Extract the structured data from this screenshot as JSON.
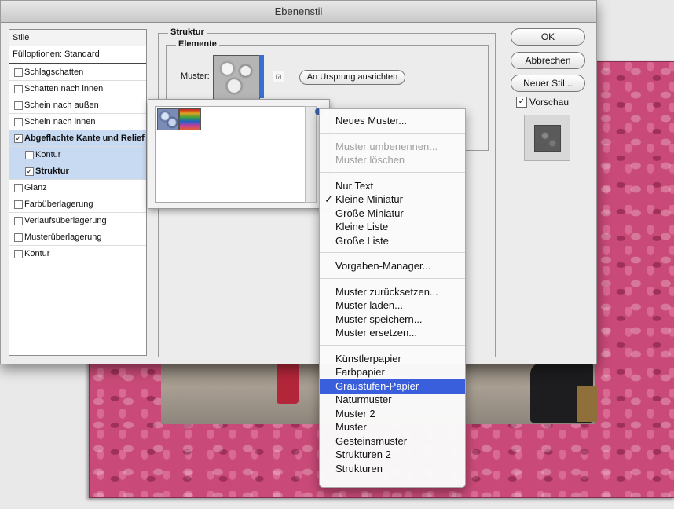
{
  "window": {
    "title": "Ebenenstil"
  },
  "styles_panel": {
    "header": "Stile",
    "fill_options": "Fülloptionen: Standard",
    "items": [
      {
        "label": "Schlagschatten",
        "checked": false,
        "sub": false,
        "selected": false,
        "bold": false
      },
      {
        "label": "Schatten nach innen",
        "checked": false,
        "sub": false,
        "selected": false,
        "bold": false
      },
      {
        "label": "Schein nach außen",
        "checked": false,
        "sub": false,
        "selected": false,
        "bold": false
      },
      {
        "label": "Schein nach innen",
        "checked": false,
        "sub": false,
        "selected": false,
        "bold": false
      },
      {
        "label": "Abgeflachte Kante und Relief",
        "checked": true,
        "sub": false,
        "selected": true,
        "bold": true
      },
      {
        "label": "Kontur",
        "checked": false,
        "sub": true,
        "selected": true,
        "bold": false
      },
      {
        "label": "Struktur",
        "checked": true,
        "sub": true,
        "selected": true,
        "bold": true
      },
      {
        "label": "Glanz",
        "checked": false,
        "sub": false,
        "selected": false,
        "bold": false
      },
      {
        "label": "Farbüberlagerung",
        "checked": false,
        "sub": false,
        "selected": false,
        "bold": false
      },
      {
        "label": "Verlaufsüberlagerung",
        "checked": false,
        "sub": false,
        "selected": false,
        "bold": false
      },
      {
        "label": "Musterüberlagerung",
        "checked": false,
        "sub": false,
        "selected": false,
        "bold": false
      },
      {
        "label": "Kontur",
        "checked": false,
        "sub": false,
        "selected": false,
        "bold": false
      }
    ]
  },
  "structure": {
    "title": "Struktur",
    "elements_title": "Elemente",
    "pattern_label": "Muster:",
    "snap_button": "An Ursprung ausrichten"
  },
  "buttons": {
    "ok": "OK",
    "cancel": "Abbrechen",
    "new_style": "Neuer Stil...",
    "preview": "Vorschau",
    "preview_checked": true
  },
  "menu": {
    "groups": [
      [
        {
          "label": "Neues Muster...",
          "enabled": true
        }
      ],
      [
        {
          "label": "Muster umbenennen...",
          "enabled": false
        },
        {
          "label": "Muster löschen",
          "enabled": false
        }
      ],
      [
        {
          "label": "Nur Text",
          "enabled": true
        },
        {
          "label": "Kleine Miniatur",
          "enabled": true,
          "checked": true
        },
        {
          "label": "Große Miniatur",
          "enabled": true
        },
        {
          "label": "Kleine Liste",
          "enabled": true
        },
        {
          "label": "Große Liste",
          "enabled": true
        }
      ],
      [
        {
          "label": "Vorgaben-Manager...",
          "enabled": true
        }
      ],
      [
        {
          "label": "Muster zurücksetzen...",
          "enabled": true
        },
        {
          "label": "Muster laden...",
          "enabled": true
        },
        {
          "label": "Muster speichern...",
          "enabled": true
        },
        {
          "label": "Muster ersetzen...",
          "enabled": true
        }
      ],
      [
        {
          "label": "Künstlerpapier",
          "enabled": true
        },
        {
          "label": "Farbpapier",
          "enabled": true
        },
        {
          "label": "Graustufen-Papier",
          "enabled": true,
          "highlighted": true
        },
        {
          "label": "Naturmuster",
          "enabled": true
        },
        {
          "label": "Muster 2",
          "enabled": true
        },
        {
          "label": "Muster",
          "enabled": true
        },
        {
          "label": "Gesteinsmuster",
          "enabled": true
        },
        {
          "label": "Strukturen 2",
          "enabled": true
        },
        {
          "label": "Strukturen",
          "enabled": true
        }
      ]
    ],
    "check_glyph": "✓",
    "highlight_color": "#3a5fdc"
  }
}
